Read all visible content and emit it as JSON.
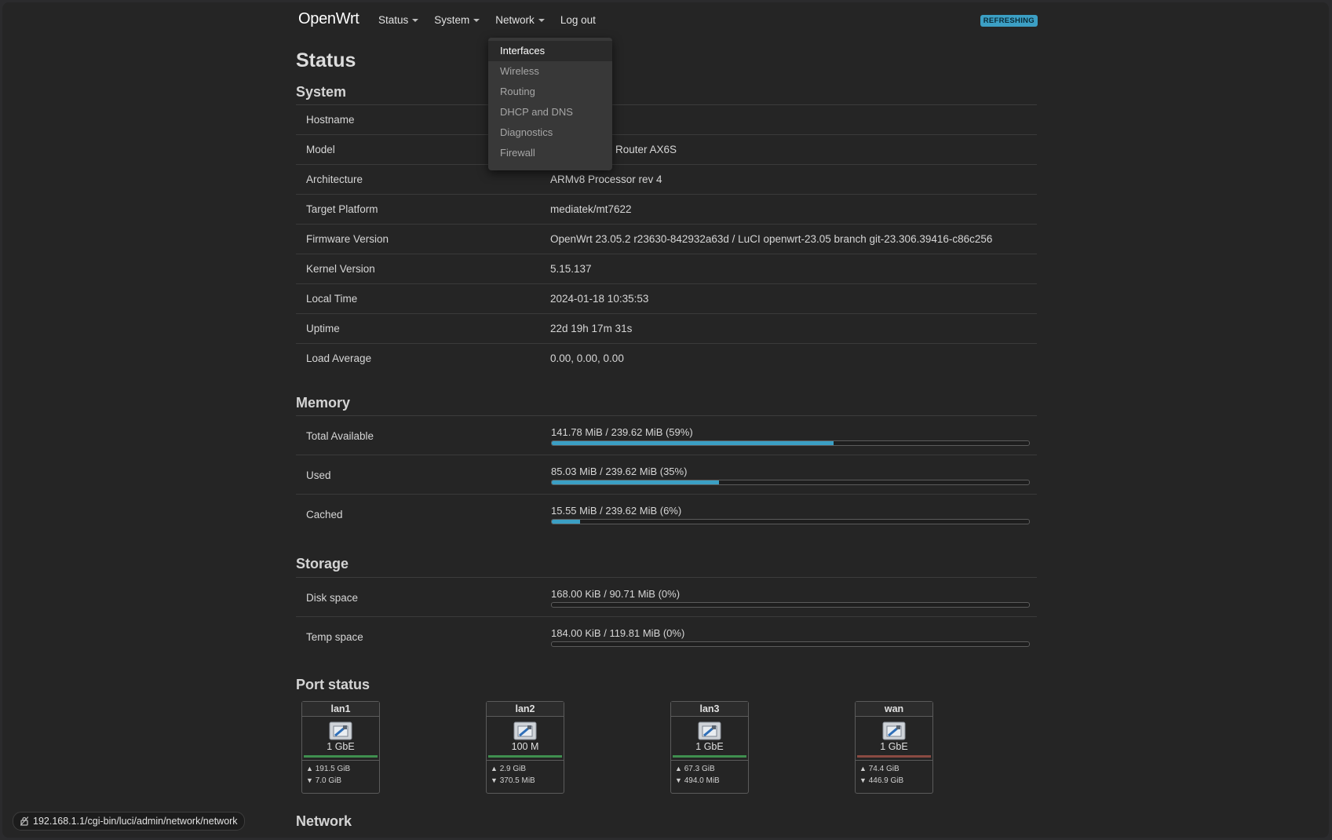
{
  "header": {
    "brand": "OpenWrt",
    "nav": [
      {
        "label": "Status",
        "has_caret": true
      },
      {
        "label": "System",
        "has_caret": true
      },
      {
        "label": "Network",
        "has_caret": true
      },
      {
        "label": "Log out",
        "has_caret": false
      }
    ],
    "badge": "REFRESHING"
  },
  "network_menu": {
    "items": [
      "Interfaces",
      "Wireless",
      "Routing",
      "DHCP and DNS",
      "Diagnostics",
      "Firewall"
    ],
    "active": "Interfaces"
  },
  "page_title": "Status",
  "system": {
    "heading": "System",
    "rows": [
      {
        "key": "Hostname",
        "value": ""
      },
      {
        "key": "Model",
        "value": "Router AX6S"
      },
      {
        "key": "Architecture",
        "value": "ARMv8 Processor rev 4"
      },
      {
        "key": "Target Platform",
        "value": "mediatek/mt7622"
      },
      {
        "key": "Firmware Version",
        "value": "OpenWrt 23.05.2 r23630-842932a63d / LuCI openwrt-23.05 branch git-23.306.39416-c86c256"
      },
      {
        "key": "Kernel Version",
        "value": "5.15.137"
      },
      {
        "key": "Local Time",
        "value": "2024-01-18 10:35:53"
      },
      {
        "key": "Uptime",
        "value": "22d 19h 17m 31s"
      },
      {
        "key": "Load Average",
        "value": "0.00, 0.00, 0.00"
      }
    ]
  },
  "memory": {
    "heading": "Memory",
    "rows": [
      {
        "key": "Total Available",
        "label": "141.78 MiB / 239.62 MiB (59%)",
        "fraction": 0.59
      },
      {
        "key": "Used",
        "label": "85.03 MiB / 239.62 MiB (35%)",
        "fraction": 0.35
      },
      {
        "key": "Cached",
        "label": "15.55 MiB / 239.62 MiB (6%)",
        "fraction": 0.06
      }
    ]
  },
  "storage": {
    "heading": "Storage",
    "rows": [
      {
        "key": "Disk space",
        "label": "168.00 KiB / 90.71 MiB (0%)",
        "fraction": 0.0
      },
      {
        "key": "Temp space",
        "label": "184.00 KiB / 119.81 MiB (0%)",
        "fraction": 0.0
      }
    ]
  },
  "ports": {
    "heading": "Port status",
    "items": [
      {
        "name": "lan1",
        "speed": "1 GbE",
        "tx": "191.5 GiB",
        "rx": "7.0 GiB",
        "status_color": "#3f8f4f"
      },
      {
        "name": "lan2",
        "speed": "100 M",
        "tx": "2.9 GiB",
        "rx": "370.5 MiB",
        "status_color": "#3f8f4f"
      },
      {
        "name": "lan3",
        "speed": "1 GbE",
        "tx": "67.3 GiB",
        "rx": "494.0 MiB",
        "status_color": "#3f8f4f"
      },
      {
        "name": "wan",
        "speed": "1 GbE",
        "tx": "74.4 GiB",
        "rx": "446.9 GiB",
        "status_color": "#8a4a42"
      }
    ],
    "tx_symbol": "▲",
    "rx_symbol": "▼"
  },
  "network": {
    "heading": "Network"
  },
  "statusbar": {
    "url": "192.168.1.1/cgi-bin/luci/admin/network/network"
  },
  "colors": {
    "accent": "#3b9fc4",
    "background": "#252525"
  }
}
